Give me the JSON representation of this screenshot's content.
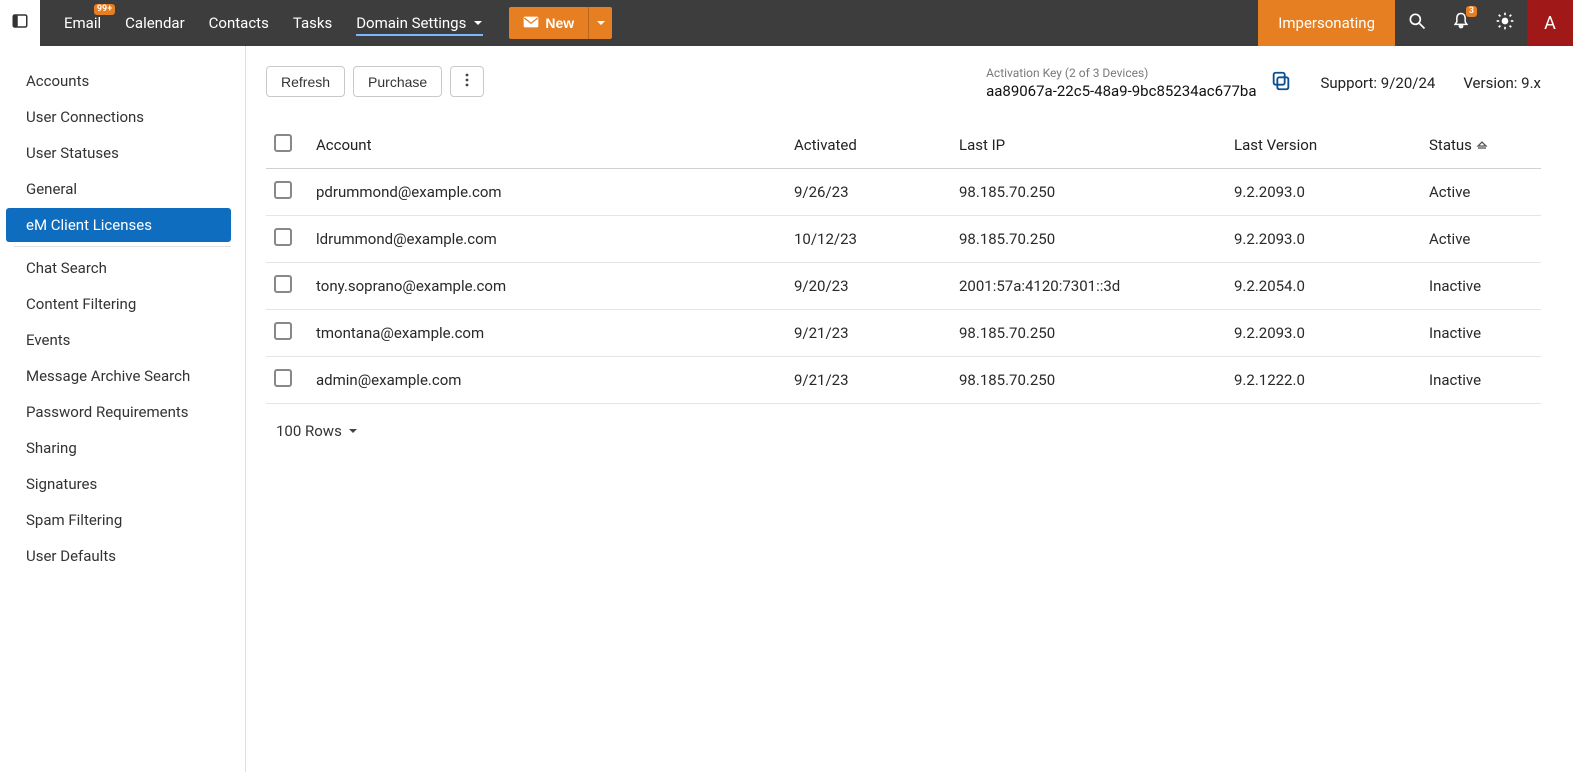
{
  "topnav": {
    "items": [
      {
        "label": "Email",
        "badge": "99+"
      },
      {
        "label": "Calendar"
      },
      {
        "label": "Contacts"
      },
      {
        "label": "Tasks"
      },
      {
        "label": "Domain Settings",
        "active": true,
        "dropdown": true
      }
    ],
    "new_button": "New",
    "impersonating": "Impersonating",
    "notif_badge": "3",
    "avatar_initial": "A"
  },
  "sidebar": {
    "group1": [
      {
        "label": "Accounts"
      },
      {
        "label": "User Connections"
      },
      {
        "label": "User Statuses"
      },
      {
        "label": "General"
      },
      {
        "label": "eM Client Licenses",
        "active": true
      }
    ],
    "group2": [
      {
        "label": "Chat Search"
      },
      {
        "label": "Content Filtering"
      },
      {
        "label": "Events"
      },
      {
        "label": "Message Archive Search"
      },
      {
        "label": "Password Requirements"
      },
      {
        "label": "Sharing"
      },
      {
        "label": "Signatures"
      },
      {
        "label": "Spam Filtering"
      },
      {
        "label": "User Defaults"
      }
    ]
  },
  "toolbar": {
    "refresh": "Refresh",
    "purchase": "Purchase",
    "activation_label": "Activation Key (2 of 3 Devices)",
    "activation_key": "aa89067a-22c5-48a9-9bc85234ac677ba",
    "support": "Support: 9/20/24",
    "version": "Version: 9.x"
  },
  "table": {
    "headers": {
      "account": "Account",
      "activated": "Activated",
      "lastip": "Last IP",
      "lastversion": "Last Version",
      "status": "Status"
    },
    "rows": [
      {
        "account": "pdrummond@example.com",
        "activated": "9/26/23",
        "lastip": "98.185.70.250",
        "lastversion": "9.2.2093.0",
        "status": "Active"
      },
      {
        "account": "ldrummond@example.com",
        "activated": "10/12/23",
        "lastip": "98.185.70.250",
        "lastversion": "9.2.2093.0",
        "status": "Active"
      },
      {
        "account": "tony.soprano@example.com",
        "activated": "9/20/23",
        "lastip": "2001:57a:4120:7301::3d",
        "lastversion": "9.2.2054.0",
        "status": "Inactive"
      },
      {
        "account": "tmontana@example.com",
        "activated": "9/21/23",
        "lastip": "98.185.70.250",
        "lastversion": "9.2.2093.0",
        "status": "Inactive"
      },
      {
        "account": "admin@example.com",
        "activated": "9/21/23",
        "lastip": "98.185.70.250",
        "lastversion": "9.2.1222.0",
        "status": "Inactive"
      }
    ]
  },
  "rows_selector": "100 Rows"
}
